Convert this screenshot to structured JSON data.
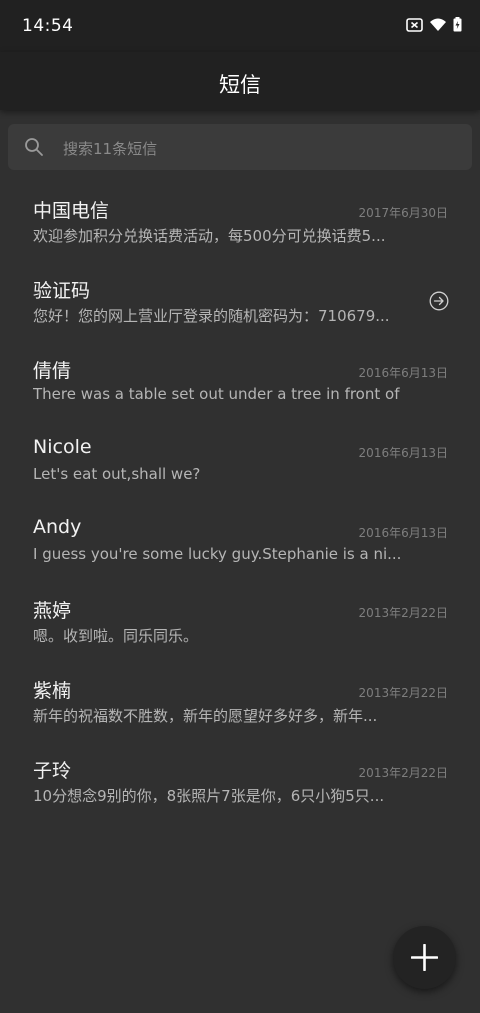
{
  "status_bar": {
    "time": "14:54",
    "icons": [
      "sim-x-icon",
      "wifi-icon",
      "battery-charging-icon"
    ]
  },
  "app_bar": {
    "title": "短信"
  },
  "search": {
    "placeholder": "搜索11条短信",
    "icon": "search-icon"
  },
  "messages": [
    {
      "sender": "中国电信",
      "preview": "欢迎参加积分兑换话费活动，每500分可兑换话费5...",
      "date": "2017年6月30日"
    },
    {
      "sender": "验证码",
      "preview": "您好！您的网上营业厅登录的随机密码为：710679...",
      "date": "",
      "icon": "arrow-right-circle-icon"
    },
    {
      "sender": "倩倩",
      "preview": "There was a table set out under a tree in front of ...",
      "date": "2016年6月13日"
    },
    {
      "sender": "Nicole",
      "preview": "Let's eat out,shall we?",
      "date": "2016年6月13日"
    },
    {
      "sender": "Andy",
      "preview": "I guess you're some lucky guy.Stephanie is a ni...",
      "date": "2016年6月13日"
    },
    {
      "sender": "燕婷",
      "preview": "嗯。收到啦。同乐同乐。",
      "date": "2013年2月22日"
    },
    {
      "sender": "紫楠",
      "preview": "新年的祝福数不胜数，新年的愿望好多好多，新年...",
      "date": "2013年2月22日"
    },
    {
      "sender": "子玲",
      "preview": "10分想念9别的你，8张照片7张是你，6只小狗5只...",
      "date": "2013年2月22日"
    }
  ],
  "fab": {
    "icon": "plus-icon"
  },
  "colors": {
    "background": "#303030",
    "app_bar": "#212121",
    "search_bg": "#3b3b3b",
    "fab_bg": "#232323"
  }
}
